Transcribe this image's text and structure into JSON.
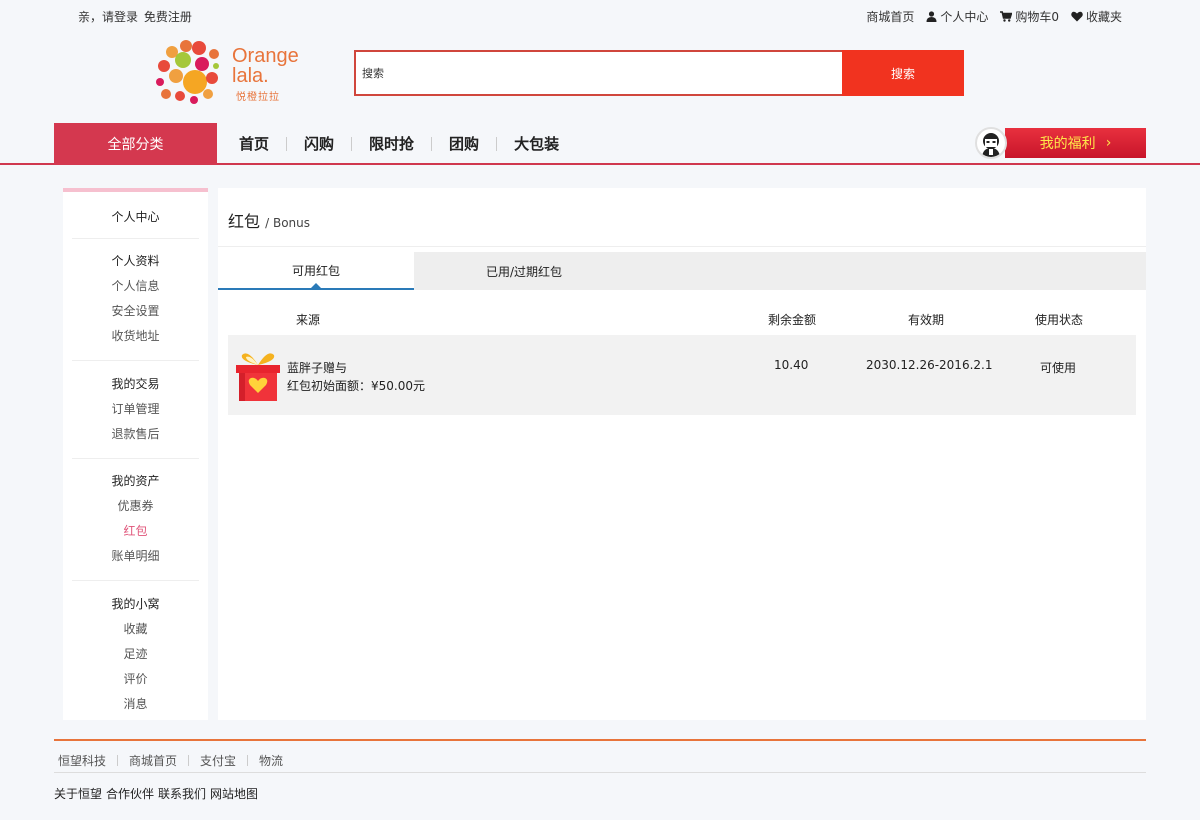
{
  "topbar": {
    "greeting": "亲，请登录",
    "register": "免费注册",
    "links": [
      {
        "label": "商城首页",
        "icon": ""
      },
      {
        "label": "个人中心",
        "icon": "user-icon"
      },
      {
        "label": "购物车0",
        "icon": "cart-icon"
      },
      {
        "label": "收藏夹",
        "icon": "heart-icon"
      }
    ]
  },
  "logo": {
    "name": "Orange\nlala.",
    "name_line1": "Orange",
    "name_line2": "lala.",
    "sub": "悦橙拉拉"
  },
  "search": {
    "placeholder": "搜索",
    "button": "搜索"
  },
  "nav": {
    "all_categories": "全部分类",
    "links": [
      "首页",
      "闪购",
      "限时抢",
      "团购",
      "大包装"
    ],
    "welfare": "我的福利",
    "welfare_arrow": "›"
  },
  "sidebar": {
    "title": "个人中心",
    "sections": [
      {
        "title": "个人资料",
        "items": [
          "个人信息",
          "安全设置",
          "收货地址"
        ]
      },
      {
        "title": "我的交易",
        "items": [
          "订单管理",
          "退款售后"
        ]
      },
      {
        "title": "我的资产",
        "items": [
          "优惠券",
          "红包",
          "账单明细"
        ]
      },
      {
        "title": "我的小窝",
        "items": [
          "收藏",
          "足迹",
          "评价",
          "消息"
        ]
      }
    ],
    "active_item": "红包"
  },
  "main": {
    "title": "红包",
    "title_en": "/ Bonus",
    "tabs": [
      "可用红包",
      "已用/过期红包"
    ],
    "columns": [
      "来源",
      "剩余金额",
      "有效期",
      "使用状态"
    ],
    "rows": [
      {
        "source_line1": "蓝胖子赠与",
        "source_line2": "红包初始面额：¥50.00元",
        "remaining": "10.40",
        "validity": "2030.12.26-2016.2.1",
        "status": "可使用"
      }
    ]
  },
  "footer": {
    "links": [
      "恒望科技",
      "商城首页",
      "支付宝",
      "物流"
    ],
    "bottom": [
      "关于恒望",
      "合作伙伴",
      "联系我们",
      "网站地图"
    ]
  },
  "colors": {
    "accent": "#d4384f",
    "search": "#f1331f",
    "orange": "#e8743b",
    "tab": "#2a7ab8"
  }
}
